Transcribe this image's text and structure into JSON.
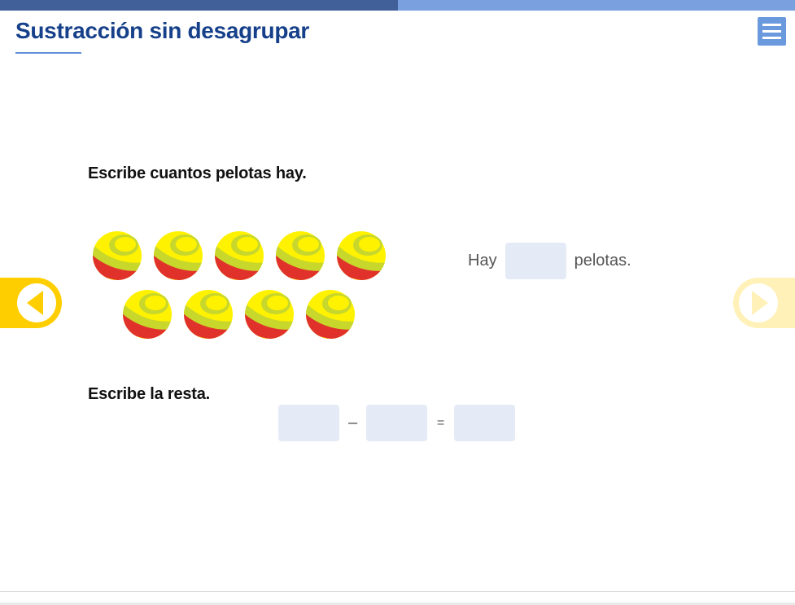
{
  "progress": {
    "value": 0.5
  },
  "header": {
    "title": "Sustracción sin desagrupar",
    "menu_icon": "hamburger-menu-icon"
  },
  "question1": {
    "instruction": "Escribe cuantos pelotas hay.",
    "balls_count": 9,
    "hay_label": "Hay",
    "pelotas_label": "pelotas.",
    "answer_value": ""
  },
  "question2": {
    "instruction": "Escribe la resta.",
    "minus_sign": "–",
    "equals_sign": "=",
    "operand1_value": "",
    "operand2_value": "",
    "result_value": ""
  },
  "navigation": {
    "prev_icon": "arrow-left-icon",
    "next_icon": "arrow-right-icon"
  },
  "colors": {
    "title": "#16408a",
    "progress_done": "#41609a",
    "progress_track": "#7aa0df",
    "menu_button": "#6b99de",
    "nav_active": "#ffce00",
    "nav_inactive": "#fff1b8",
    "input_box": "#e4ebf7",
    "ball_yellow": "#fff200",
    "ball_green": "#c8d72c",
    "ball_red": "#e0322a"
  }
}
